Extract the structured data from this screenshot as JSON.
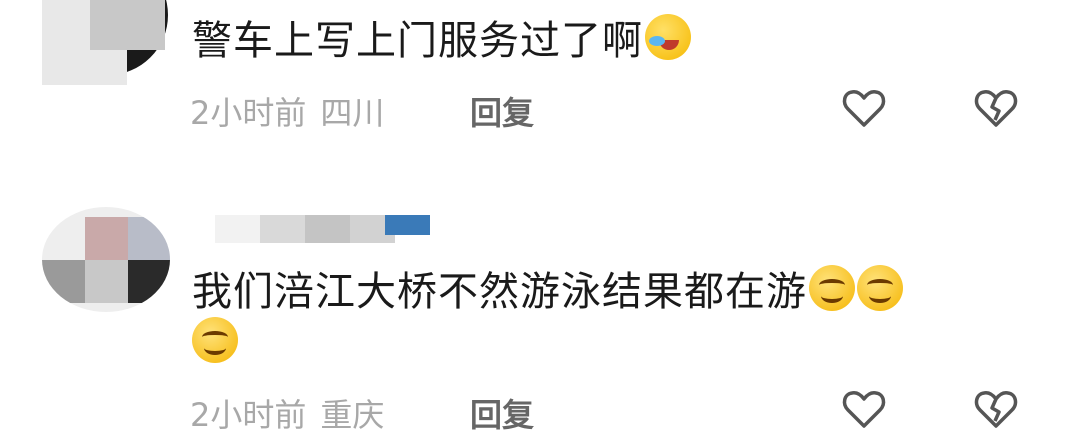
{
  "comments": [
    {
      "text": "警车上写上门服务过了啊",
      "emoji": "laughing-with-tears-emoji",
      "time": "2小时前",
      "location": "四川",
      "reply_label": "回复",
      "like_icon": "heart-outline-icon",
      "dislike_icon": "broken-heart-outline-icon"
    },
    {
      "text": "我们涪江大桥不然游泳结果都在游",
      "emoji": "smiling-face-emoji",
      "time": "2小时前",
      "location": "重庆",
      "reply_label": "回复",
      "like_icon": "heart-outline-icon",
      "dislike_icon": "broken-heart-outline-icon"
    }
  ],
  "colors": {
    "text": "#1a1a1a",
    "meta": "#a8a8a8",
    "reply": "#666666",
    "icon": "#555555"
  }
}
